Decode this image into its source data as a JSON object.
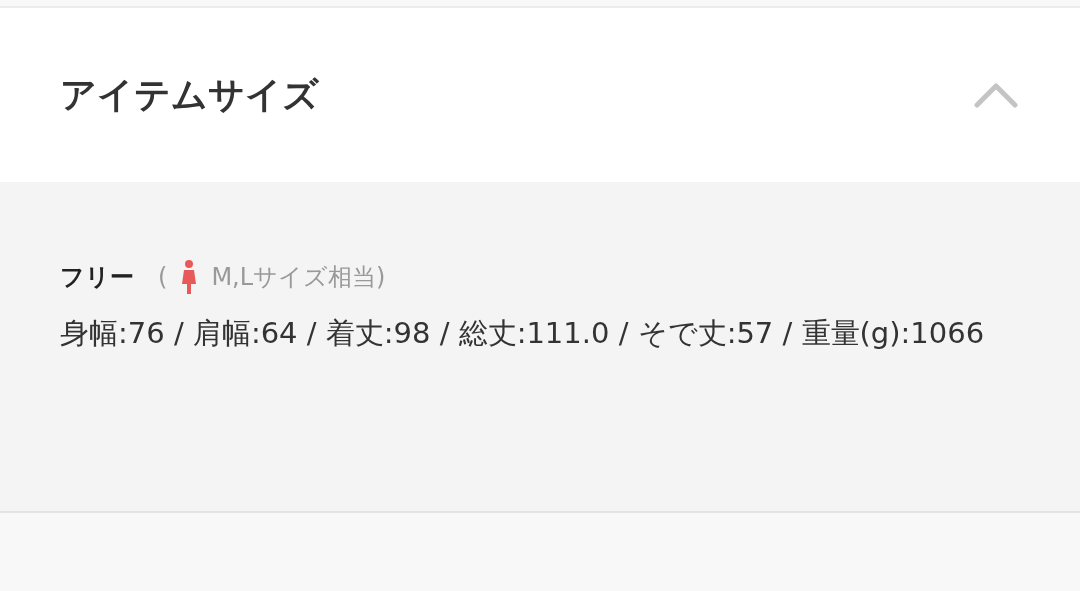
{
  "section": {
    "title": "アイテムサイズ",
    "expanded": true
  },
  "sizes": [
    {
      "name": "フリー",
      "open_paren": "(",
      "equivalent": "M,Lサイズ相当)",
      "measurements": "身幅:76 / 肩幅:64 / 着丈:98 / 総丈:111.0 / そで丈:57 / 重量(g):1066"
    }
  ]
}
